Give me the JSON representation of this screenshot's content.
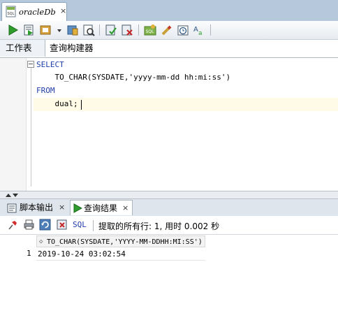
{
  "document_tab": {
    "title": "oracleDb",
    "close": "×"
  },
  "worksheet_tabs": [
    "工作表",
    "查询构建器"
  ],
  "editor": {
    "lines": [
      "SELECT",
      "    TO_CHAR(SYSDATE,'yyyy-mm-dd hh:mi:ss')",
      "FROM",
      "    dual;"
    ]
  },
  "output_tabs": [
    {
      "label": "脚本输出",
      "close": "×"
    },
    {
      "label": "查询结果",
      "close": "×"
    }
  ],
  "result_toolbar": {
    "sql_label": "SQL",
    "status": "提取的所有行: 1, 用时 0.002 秒"
  },
  "result_grid": {
    "columns": [
      "TO_CHAR(SYSDATE,'YYYY-MM-DDHH:MI:SS')"
    ],
    "rows": [
      {
        "num": "1",
        "cells": [
          "2019-10-24 03:02:54"
        ]
      }
    ]
  },
  "icons": [
    "sql-file-icon",
    "run-icon",
    "run-script-icon",
    "commit-icon",
    "rollback-icon",
    "autotrace-icon",
    "explain-plan-icon",
    "sql-tuning-icon",
    "clear-icon",
    "history-icon",
    "format-icon",
    "pin-icon",
    "print-icon",
    "refresh-icon",
    "export-icon"
  ]
}
